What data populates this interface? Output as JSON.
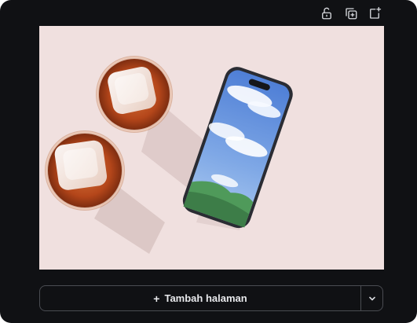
{
  "toolbar": {
    "lock_icon": "unlock-icon",
    "duplicate_icon": "duplicate-page-icon",
    "add_icon": "add-page-icon"
  },
  "canvas": {
    "image_subject": "two glasses of iced tea beside a smartphone with sky wallpaper",
    "background_color": "#f0e0df"
  },
  "footer": {
    "add_page_plus": "+",
    "add_page_label": "Tambah halaman",
    "more_icon": "chevron-down-icon"
  },
  "colors": {
    "panel_bg": "#101114",
    "icon": "#d7d9de",
    "border": "#4a4c52",
    "text": "#e8e9ec"
  }
}
